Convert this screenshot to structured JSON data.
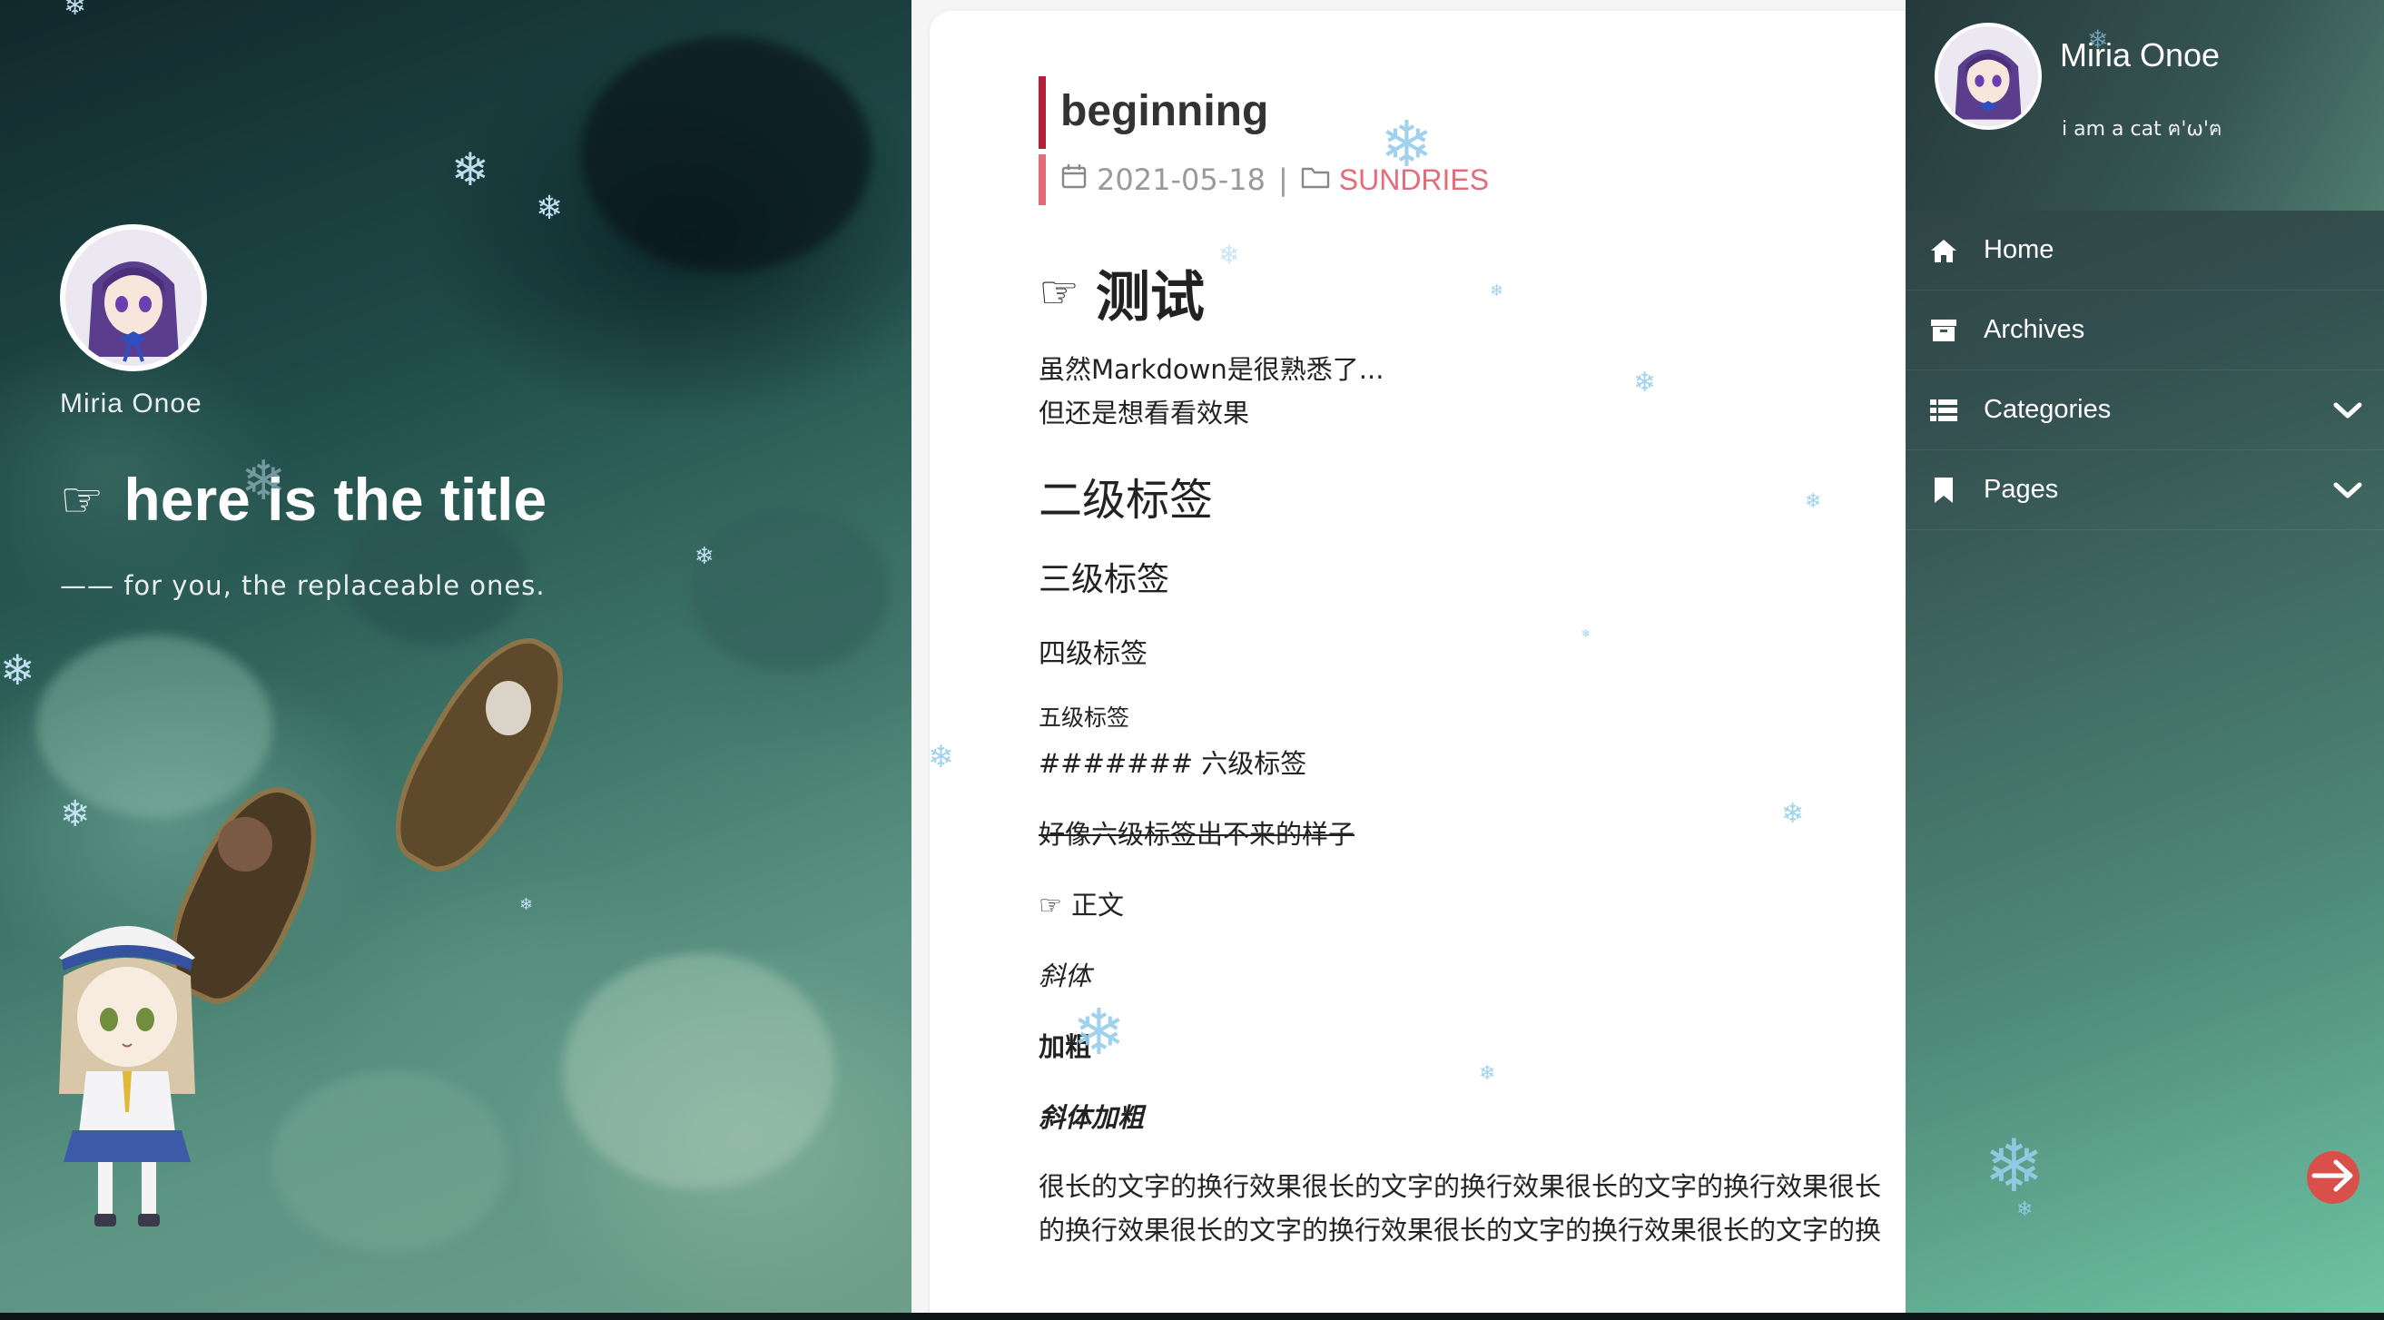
{
  "hero": {
    "author_name": "Miria Onoe",
    "title_icon": "pointing-hand-icon",
    "title_glyph": "☞",
    "title": "here is the title",
    "subtitle": "—— for you, the replaceable ones."
  },
  "post": {
    "title": "beginning",
    "date": "2021-05-18",
    "meta_separator": "|",
    "category": "SUNDRIES",
    "body": {
      "h1_glyph": "☞",
      "h1": "测试",
      "intro_line1": "虽然Markdown是很熟悉了...",
      "intro_line2": "但还是想看看效果",
      "h2": "二级标签",
      "h3": "三级标签",
      "h4": "四级标签",
      "h5": "五级标签",
      "h6_raw": "####### 六级标签",
      "strikethrough": "好像六级标签出不来的样子",
      "zhengwen_glyph": "☞",
      "zhengwen": "正文",
      "italic": "斜体",
      "bold": "加粗",
      "bold_italic": "斜体加粗",
      "long_line1": "很长的文字的换行效果很长的文字的换行效果很长的文字的换行效果很长",
      "long_line2": "的换行效果很长的文字的换行效果很长的文字的换行效果很长的文字的换"
    }
  },
  "nav": {
    "author_name": "Miria Onoe",
    "bio": "i am a cat ฅ'ω'ฅ",
    "items": [
      {
        "label": "Home",
        "icon": "home-icon",
        "has_submenu": false
      },
      {
        "label": "Archives",
        "icon": "archive-icon",
        "has_submenu": false
      },
      {
        "label": "Categories",
        "icon": "list-icon",
        "has_submenu": true
      },
      {
        "label": "Pages",
        "icon": "bookmark-icon",
        "has_submenu": true
      }
    ],
    "close_icon": "arrow-right-icon"
  },
  "colors": {
    "accent_red": "#b3213b",
    "accent_pink": "#e46c79",
    "close_button": "#d9504a",
    "nav_gradient_end": "#6fc4a5"
  }
}
